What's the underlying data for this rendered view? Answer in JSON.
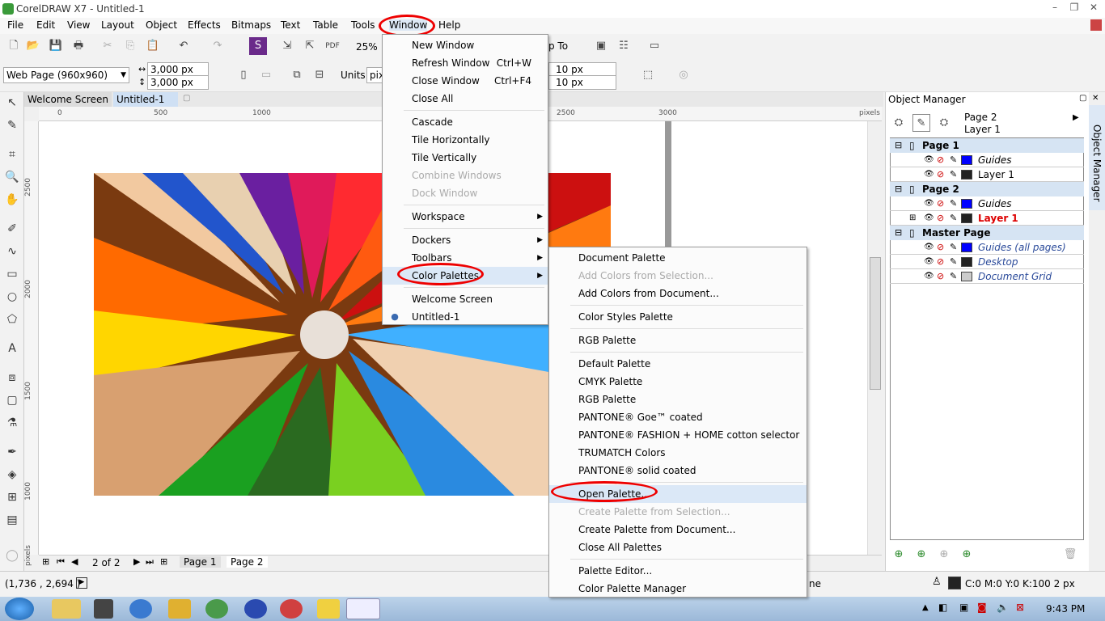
{
  "title": "CorelDRAW X7 - Untitled-1",
  "menubar": [
    "File",
    "Edit",
    "View",
    "Layout",
    "Object",
    "Effects",
    "Bitmaps",
    "Text",
    "Table",
    "Tools",
    "Window",
    "Help"
  ],
  "toolbar": {
    "zoom": "25%",
    "snap_to": "p To"
  },
  "props": {
    "preset": "Web Page (960x960)",
    "width": "3,000 px",
    "height": "3,000 px",
    "units_label": "Units:",
    "units_value": "pix",
    "nudge1": "10 px",
    "nudge2": "10 px"
  },
  "doc_tabs": [
    "Welcome Screen",
    "Untitled-1"
  ],
  "ruler_h": [
    "0",
    "500",
    "1000",
    "2500",
    "3000",
    "pixels"
  ],
  "ruler_v": [
    "2500",
    "2000",
    "1500",
    "1000",
    "pixels"
  ],
  "page_nav": {
    "counter": "2 of 2",
    "tabs": [
      "Page 1",
      "Page 2"
    ]
  },
  "status": {
    "coords": "(1,736 , 2,694 )",
    "partial": "ne",
    "fill": "C:0 M:0 Y:0 K:100  2 px"
  },
  "clock": "9:43 PM",
  "object_manager": {
    "title": "Object Manager",
    "side_label": "Object Manager",
    "current_page": "Page 2",
    "current_layer": "Layer 1",
    "rows": [
      {
        "label": "Page 1",
        "type": "page",
        "color": "#000"
      },
      {
        "label": "Guides",
        "type": "layer",
        "color": "#0000ff"
      },
      {
        "label": "Layer 1",
        "type": "layer",
        "color": "#222222"
      },
      {
        "label": "Page 2",
        "type": "page",
        "color": "#000"
      },
      {
        "label": "Guides",
        "type": "layer",
        "color": "#0000ff"
      },
      {
        "label": "Layer 1",
        "type": "active",
        "color": "#222222"
      },
      {
        "label": "Master Page",
        "type": "page",
        "color": "#000"
      },
      {
        "label": "Guides (all pages)",
        "type": "master",
        "color": "#0000ff"
      },
      {
        "label": "Desktop",
        "type": "master",
        "color": "#222222"
      },
      {
        "label": "Document Grid",
        "type": "master",
        "color": "#cccccc"
      }
    ]
  },
  "window_menu": [
    {
      "label": "New Window",
      "shortcut": "",
      "disabled": false
    },
    {
      "label": "Refresh Window",
      "shortcut": "Ctrl+W",
      "disabled": false
    },
    {
      "label": "Close Window",
      "shortcut": "Ctrl+F4",
      "disabled": false
    },
    {
      "label": "Close All",
      "shortcut": "",
      "disabled": false
    },
    {
      "sep": true
    },
    {
      "label": "Cascade",
      "disabled": false
    },
    {
      "label": "Tile Horizontally",
      "disabled": false
    },
    {
      "label": "Tile Vertically",
      "disabled": false
    },
    {
      "label": "Combine Windows",
      "disabled": true
    },
    {
      "label": "Dock Window",
      "disabled": true
    },
    {
      "sep": true
    },
    {
      "label": "Workspace",
      "sub": true
    },
    {
      "sep": true
    },
    {
      "label": "Dockers",
      "sub": true
    },
    {
      "label": "Toolbars",
      "sub": true
    },
    {
      "label": "Color Palettes",
      "sub": true,
      "highlight": true
    },
    {
      "sep": true
    },
    {
      "label": "Welcome Screen"
    },
    {
      "label": "Untitled-1",
      "radio": true
    }
  ],
  "palette_menu": [
    {
      "label": "Document Palette"
    },
    {
      "label": "Add Colors from Selection...",
      "disabled": true
    },
    {
      "label": "Add Colors from Document..."
    },
    {
      "sep": true
    },
    {
      "label": "Color Styles Palette"
    },
    {
      "sep": true
    },
    {
      "label": "RGB Palette"
    },
    {
      "sep": true
    },
    {
      "label": "Default Palette"
    },
    {
      "label": "CMYK Palette"
    },
    {
      "label": "RGB Palette"
    },
    {
      "label": "PANTONE® Goe™ coated"
    },
    {
      "label": "PANTONE® FASHION + HOME cotton selector"
    },
    {
      "label": "TRUMATCH Colors"
    },
    {
      "label": "PANTONE® solid coated"
    },
    {
      "sep": true
    },
    {
      "label": "Open Palette...",
      "highlight": true
    },
    {
      "label": "Create Palette from Selection...",
      "disabled": true
    },
    {
      "label": "Create Palette from Document..."
    },
    {
      "label": "Close All Palettes"
    },
    {
      "sep": true
    },
    {
      "label": "Palette Editor..."
    },
    {
      "label": "Color Palette Manager"
    }
  ]
}
